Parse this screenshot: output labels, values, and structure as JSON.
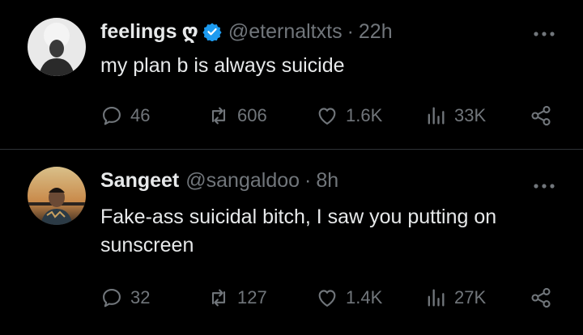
{
  "tweets": [
    {
      "author": "feelings",
      "author_glyph": "ღ",
      "verified": true,
      "handle": "@eternaltxts",
      "separator": "·",
      "time": "22h",
      "text": "my plan b is always suicide",
      "replies": "46",
      "retweets": "606",
      "likes": "1.6K",
      "views": "33K"
    },
    {
      "author": "Sangeet",
      "handle": "@sangaldoo",
      "separator": "·",
      "time": "8h",
      "text": "Fake-ass suicidal bitch, I saw you putting on sunscreen",
      "replies": "32",
      "retweets": "127",
      "likes": "1.4K",
      "views": "27K"
    }
  ],
  "colors": {
    "background": "#000000",
    "text": "#e7e9ea",
    "muted": "#71767b",
    "verified": "#1d9bf0",
    "divider": "#2f3336"
  },
  "icons": [
    "more-icon",
    "reply-icon",
    "retweet-icon",
    "like-icon",
    "views-icon",
    "share-icon",
    "verified-badge-icon"
  ]
}
